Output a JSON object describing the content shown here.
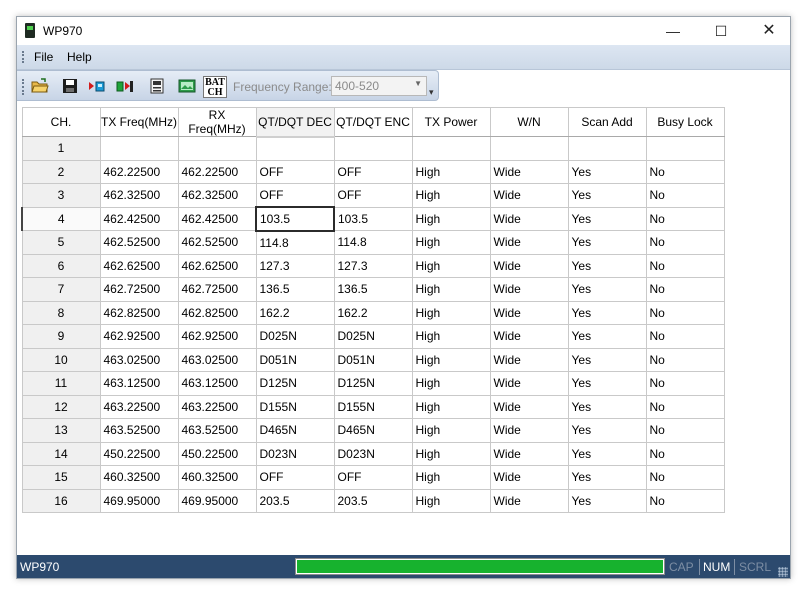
{
  "window": {
    "title": "WP970",
    "minimize_symbol": "—",
    "maximize_symbol": "☐",
    "close_symbol": "✕"
  },
  "menu": {
    "items": [
      {
        "label": "File"
      },
      {
        "label": "Help"
      }
    ]
  },
  "toolbar": {
    "icons": [
      "open-folder-icon",
      "save-icon",
      "read-radio-icon",
      "write-radio-icon",
      "memory-icon",
      "image-icon"
    ],
    "batch_label": "BAT CH",
    "frequency_range_label": "Frequency Range:",
    "frequency_range_value": "400-520"
  },
  "table": {
    "columns": [
      "CH.",
      "TX Freq(MHz)",
      "RX Freq(MHz)",
      "QT/DQT DEC",
      "QT/DQT ENC",
      "TX Power",
      "W/N",
      "Scan Add",
      "Busy Lock"
    ],
    "rows": [
      [
        "1",
        "",
        "",
        "",
        "",
        "",
        "",
        "",
        ""
      ],
      [
        "2",
        "462.22500",
        "462.22500",
        "OFF",
        "OFF",
        "High",
        "Wide",
        "Yes",
        "No"
      ],
      [
        "3",
        "462.32500",
        "462.32500",
        "OFF",
        "OFF",
        "High",
        "Wide",
        "Yes",
        "No"
      ],
      [
        "4",
        "462.42500",
        "462.42500",
        "103.5",
        "103.5",
        "High",
        "Wide",
        "Yes",
        "No"
      ],
      [
        "5",
        "462.52500",
        "462.52500",
        "114.8",
        "114.8",
        "High",
        "Wide",
        "Yes",
        "No"
      ],
      [
        "6",
        "462.62500",
        "462.62500",
        "127.3",
        "127.3",
        "High",
        "Wide",
        "Yes",
        "No"
      ],
      [
        "7",
        "462.72500",
        "462.72500",
        "136.5",
        "136.5",
        "High",
        "Wide",
        "Yes",
        "No"
      ],
      [
        "8",
        "462.82500",
        "462.82500",
        "162.2",
        "162.2",
        "High",
        "Wide",
        "Yes",
        "No"
      ],
      [
        "9",
        "462.92500",
        "462.92500",
        "D025N",
        "D025N",
        "High",
        "Wide",
        "Yes",
        "No"
      ],
      [
        "10",
        "463.02500",
        "463.02500",
        "D051N",
        "D051N",
        "High",
        "Wide",
        "Yes",
        "No"
      ],
      [
        "11",
        "463.12500",
        "463.12500",
        "D125N",
        "D125N",
        "High",
        "Wide",
        "Yes",
        "No"
      ],
      [
        "12",
        "463.22500",
        "463.22500",
        "D155N",
        "D155N",
        "High",
        "Wide",
        "Yes",
        "No"
      ],
      [
        "13",
        "463.52500",
        "463.52500",
        "D465N",
        "D465N",
        "High",
        "Wide",
        "Yes",
        "No"
      ],
      [
        "14",
        "450.22500",
        "450.22500",
        "D023N",
        "D023N",
        "High",
        "Wide",
        "Yes",
        "No"
      ],
      [
        "15",
        "460.32500",
        "460.32500",
        "OFF",
        "OFF",
        "High",
        "Wide",
        "Yes",
        "No"
      ],
      [
        "16",
        "469.95000",
        "469.95000",
        "203.5",
        "203.5",
        "High",
        "Wide",
        "Yes",
        "No"
      ]
    ],
    "selected_column": 3,
    "selected_row": 3
  },
  "status": {
    "app_name": "WP970",
    "progress_fraction": 1.0,
    "progress_color": "#17b22e",
    "cap": "CAP",
    "num": "NUM",
    "scrl": "SCRL"
  }
}
